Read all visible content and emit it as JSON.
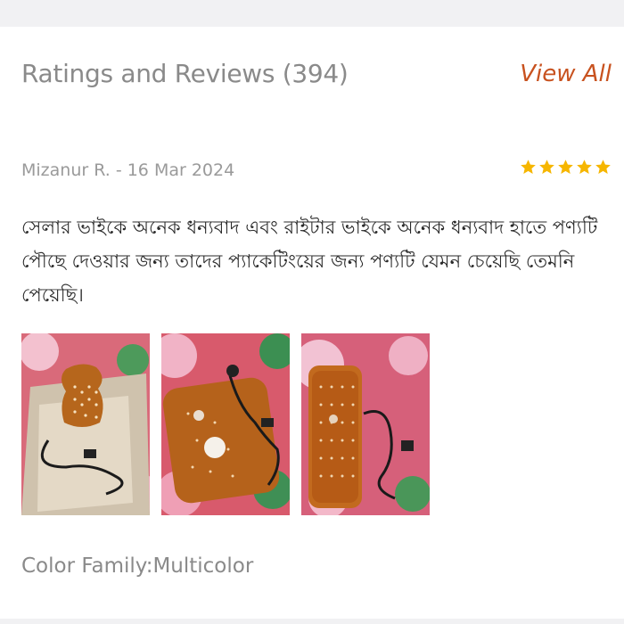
{
  "section": {
    "title": "Ratings and Reviews (394)",
    "view_all_label": "View All"
  },
  "review": {
    "reviewer_line": "Mizanur R. - 16 Mar 2024",
    "rating": 5,
    "star_color": "#f6b600",
    "text": "সেলার ভাইকে অনেক ধন্যবাদ এবং রাইটার ভাইকে অনেক ধন্যবাদ হাতে পণ্যটি পৌছে দেওয়ার জন্য তাদের প্যাকেটিংয়ের জন্য পণ্যটি যেমন চেয়েছি তেমনি পেয়েছি।",
    "photos": [
      "review-photo-box",
      "review-photo-bag-with-cable",
      "review-photo-bag-closeup"
    ],
    "variant": "Color Family:Multicolor"
  },
  "colors": {
    "accent": "#c8521f",
    "muted_text": "#8a8a8a"
  }
}
